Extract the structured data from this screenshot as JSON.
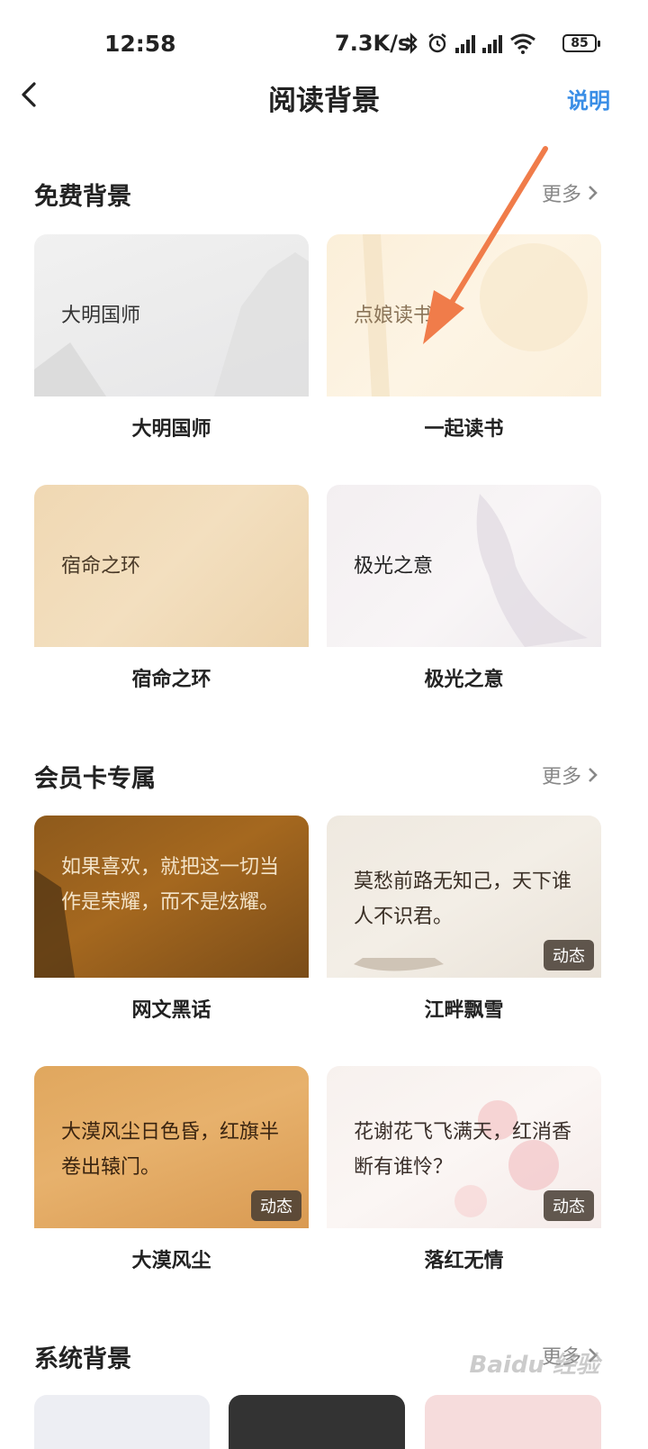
{
  "status_bar": {
    "time": "12:58",
    "speed": "7.3K/s",
    "battery": "85",
    "icons": [
      "bluetooth-icon",
      "alarm-icon",
      "signal-hd-1-icon",
      "signal-hd-2-icon",
      "wifi-icon",
      "battery-icon"
    ]
  },
  "nav": {
    "title": "阅读背景",
    "help": "说明"
  },
  "free": {
    "title": "免费背景",
    "more": "更多",
    "cards": [
      {
        "preview": "大明国师",
        "name": "大明国师"
      },
      {
        "preview": "点娘读书中",
        "name": "一起读书"
      },
      {
        "preview": "宿命之环",
        "name": "宿命之环"
      },
      {
        "preview": "极光之意",
        "name": "极光之意"
      }
    ]
  },
  "member": {
    "title": "会员卡专属",
    "more": "更多",
    "cards": [
      {
        "preview": "如果喜欢，就把这一切当作是荣耀，而不是炫耀。",
        "name": "网文黑话",
        "badge": ""
      },
      {
        "preview": "莫愁前路无知己，天下谁人不识君。",
        "name": "江畔飘雪",
        "badge": "动态"
      },
      {
        "preview": "大漠风尘日色昏，红旗半卷出辕门。",
        "name": "大漠风尘",
        "badge": "动态"
      },
      {
        "preview": "花谢花飞飞满天，红消香断有谁怜？",
        "name": "落红无情",
        "badge": "动态"
      }
    ]
  },
  "system": {
    "title": "系统背景",
    "more": "更多"
  },
  "watermark": "Baidu 经验",
  "colors": {
    "accent": "#3a8ee6",
    "arrow": "#f07c4a",
    "badge_bg": "#463c32"
  }
}
